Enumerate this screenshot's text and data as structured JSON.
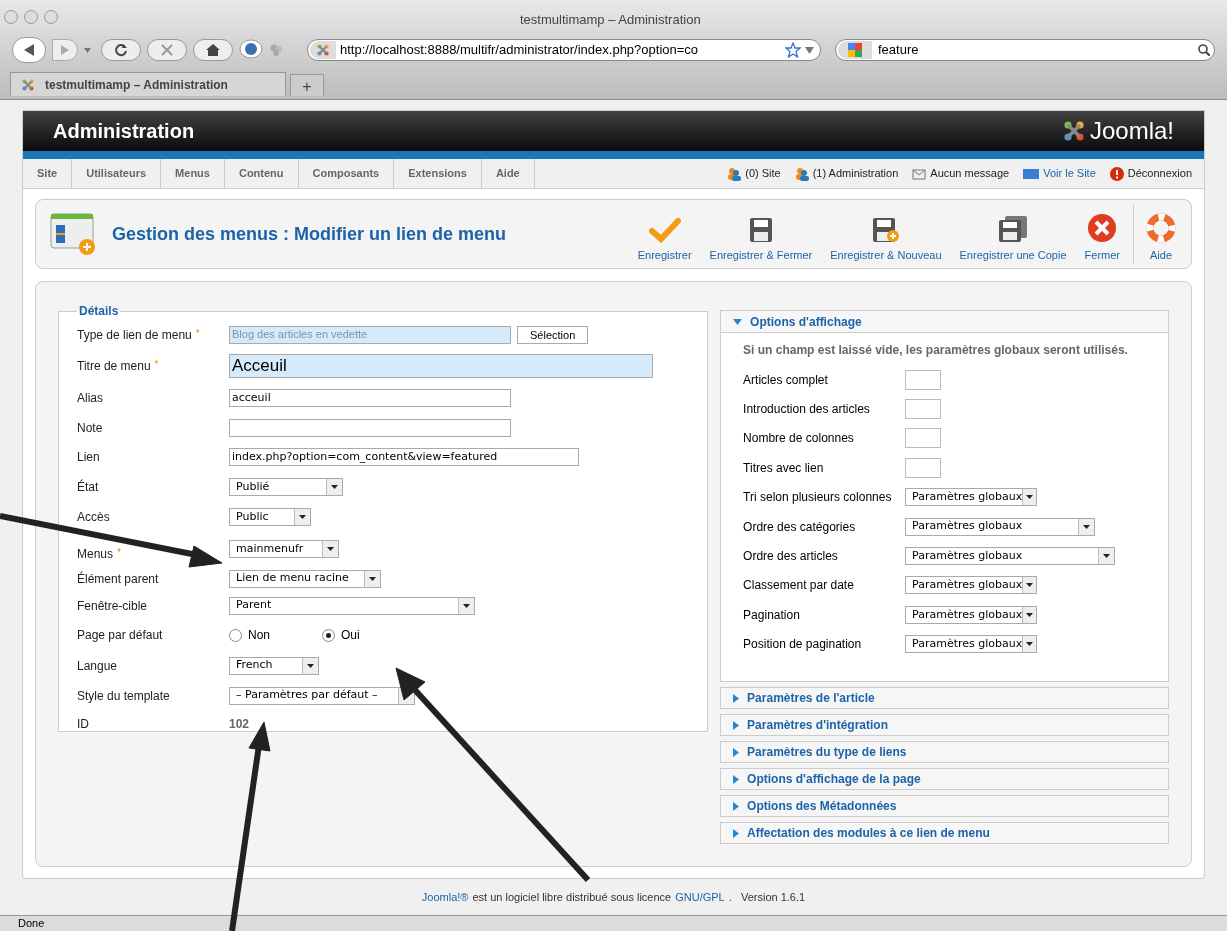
{
  "window": {
    "title": "testmultimamp – Administration"
  },
  "browser": {
    "url": "http://localhost:8888/multifr/administrator/index.php?option=co",
    "search": "feature",
    "tabs": [
      {
        "label": "testmultimamp – Administration",
        "selected": true
      }
    ],
    "new_tab": "+"
  },
  "header": {
    "title": "Administration",
    "logo": "Joomla!"
  },
  "menu": [
    "Site",
    "Utilisateurs",
    "Menus",
    "Contenu",
    "Composants",
    "Extensions",
    "Aide"
  ],
  "status_links": [
    {
      "kind": "users",
      "label": "(0) Site"
    },
    {
      "kind": "users",
      "label": "(1) Administration"
    },
    {
      "kind": "message",
      "label": "Aucun message"
    },
    {
      "kind": "view",
      "label": "Voir le Site"
    },
    {
      "kind": "logout",
      "label": "Déconnexion"
    }
  ],
  "toolbar": {
    "title": "Gestion des menus : Modifier un lien de menu",
    "buttons": [
      {
        "kind": "check",
        "label": "Enregistrer"
      },
      {
        "kind": "save",
        "label": "Enregistrer & Fermer"
      },
      {
        "kind": "save-new",
        "label": "Enregistrer & Nouveau"
      },
      {
        "kind": "copy",
        "label": "Enregistrer une Copie"
      },
      {
        "kind": "close",
        "label": "Fermer"
      },
      {
        "kind": "help",
        "label": "Aide"
      }
    ]
  },
  "details": {
    "legend": "Détails",
    "fields": [
      {
        "label": "Type de lien de menu",
        "required_mark": "*",
        "kind": "readonly",
        "value": "Blog des articles en vedette",
        "button": "Sélection"
      },
      {
        "label": "Titre de menu",
        "required_mark": "*",
        "kind": "big",
        "value": "Acceuil"
      },
      {
        "label": "Alias",
        "kind": "text",
        "value": "acceuil"
      },
      {
        "label": "Note",
        "kind": "text"
      },
      {
        "label": "Lien",
        "kind": "wide",
        "value": "index.php?option=com_content&view=featured"
      },
      {
        "label": "État",
        "kind": "select",
        "value": "Publié"
      },
      {
        "label": "Accès",
        "kind": "select",
        "value": "Public"
      },
      {
        "label": "Menus",
        "required_mark": "*",
        "kind": "select",
        "value": "mainmenufr"
      },
      {
        "label": "Élément parent",
        "kind": "select",
        "value": "Lien de menu racine"
      },
      {
        "label": "Fenêtre-cible",
        "kind": "select",
        "value": "Parent"
      },
      {
        "label": "Page par défaut",
        "kind": "radio",
        "options": [
          {
            "label": "Non",
            "selected": false
          },
          {
            "label": "Oui",
            "selected": true
          }
        ]
      },
      {
        "label": "Langue",
        "kind": "select",
        "value": "French"
      },
      {
        "label": "Style du template",
        "kind": "select",
        "value": "– Paramètres par défaut –"
      },
      {
        "label": "ID",
        "kind": "static",
        "value": "102"
      }
    ]
  },
  "options": {
    "title": "Options d'affichage",
    "expanded": true,
    "note": "Si un champ est laissé vide, les paramètres globaux seront utilisés.",
    "fields": [
      {
        "label": "Articles complet",
        "kind": "box"
      },
      {
        "label": "Introduction des articles",
        "kind": "box"
      },
      {
        "label": "Nombre de colonnes",
        "kind": "box"
      },
      {
        "label": "Titres avec lien",
        "kind": "box"
      },
      {
        "label": "Tri selon plusieurs colonnes",
        "kind": "select",
        "value": "Paramètres globaux"
      },
      {
        "label": "Ordre des catégories",
        "kind": "select",
        "value": "Paramètres globaux"
      },
      {
        "label": "Ordre des articles",
        "kind": "select",
        "value": "Paramètres globaux"
      },
      {
        "label": "Classement par date",
        "kind": "select",
        "value": "Paramètres globaux"
      },
      {
        "label": "Pagination",
        "kind": "select",
        "value": "Paramètres globaux"
      },
      {
        "label": "Position de pagination",
        "kind": "select",
        "value": "Paramètres globaux"
      }
    ]
  },
  "panels": [
    {
      "title": "Paramètres de l'article",
      "expanded": false
    },
    {
      "title": "Paramètres d'intégration",
      "expanded": false
    },
    {
      "title": "Paramètres du type de liens",
      "expanded": false
    },
    {
      "title": "Options d'affichage de la page",
      "expanded": false
    },
    {
      "title": "Options des Métadonnées",
      "expanded": false
    },
    {
      "title": "Affectation des modules à ce lien de menu",
      "expanded": false
    }
  ],
  "footer": {
    "parts": [
      {
        "kind": "link",
        "text": "Joomla!®"
      },
      {
        "kind": "text",
        "text": "est un logiciel libre distribué sous licence"
      },
      {
        "kind": "link",
        "text": "GNU/GPL"
      },
      {
        "kind": "text",
        "text": ".   Version 1.6.1"
      }
    ]
  },
  "status_bar": "Done"
}
